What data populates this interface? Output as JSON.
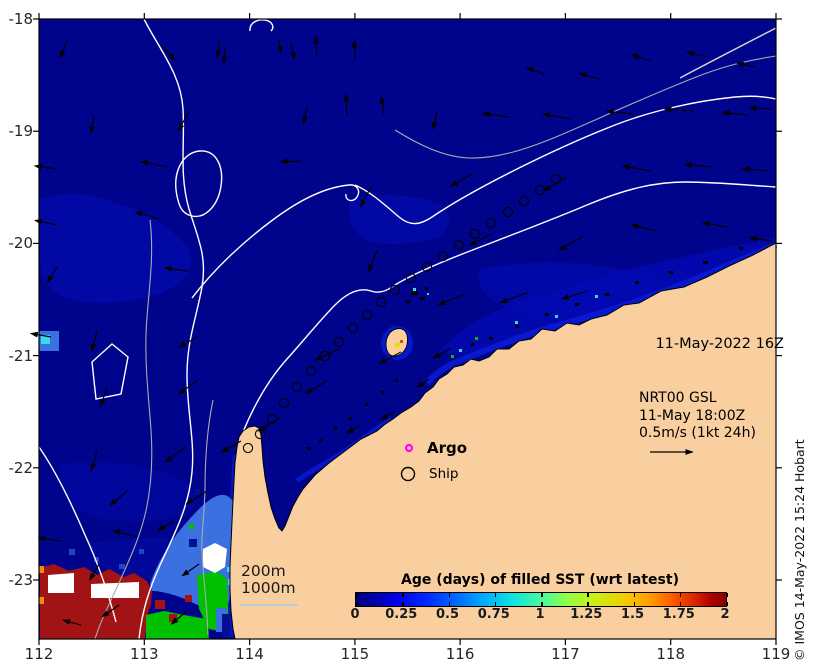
{
  "figure": {
    "date_label": "11-May-2022 16Z",
    "model_label": "NRT00 GSL",
    "model_time_label": "11-May 18:00Z",
    "scale_label": "0.5m/s (1kt 24h)",
    "copyright_label": "© IMOS 14-May-2022 15:24 Hobart"
  },
  "legend": {
    "argo_label": "Argo",
    "ship_label": "Ship"
  },
  "contour_labels": {
    "shallow": "200m",
    "deep": "1000m"
  },
  "colorbar": {
    "title": "Age (days) of filled SST (wrt latest)",
    "tick_labels": [
      "0",
      "0.25",
      "0.5",
      "0.75",
      "1",
      "1.25",
      "1.5",
      "1.75",
      "2"
    ],
    "min": 0,
    "max": 2
  },
  "axes": {
    "x_tick_labels": [
      "112",
      "113",
      "114",
      "115",
      "116",
      "117",
      "118",
      "119"
    ],
    "x_tick_pos": [
      0,
      105.3,
      210.6,
      315.9,
      421.1,
      526.4,
      631.7,
      737
    ],
    "y_tick_labels": [
      "-18",
      "-19",
      "-20",
      "-21",
      "-22",
      "-23"
    ],
    "y_tick_pos": [
      0,
      112.2,
      224.4,
      336.6,
      448.8,
      561
    ]
  },
  "colors": {
    "ocean": "#00038C",
    "land": "#FACFA0",
    "age_old_red": "#A21315",
    "patch_blue": "#3A70E0",
    "patch_green": "#00C000",
    "patch_cyan": "#38D8E8",
    "patch_white": "#FFFFFF",
    "patch_orange": "#F08C10",
    "argo_marker": "#FF00FF",
    "vector_black": "#000000",
    "contour_200m": "#FFFFFF",
    "contour_1000m": "#ABABAB"
  },
  "map": {
    "vectors": [
      [
        28,
        22,
        112,
        18
      ],
      [
        122,
        26,
        48,
        20
      ],
      [
        180,
        22,
        96,
        16
      ],
      [
        252,
        24,
        78,
        16
      ],
      [
        55,
        96,
        100,
        18
      ],
      [
        150,
        92,
        118,
        22
      ],
      [
        268,
        88,
        102,
        16
      ],
      [
        18,
        150,
        188,
        22
      ],
      [
        128,
        148,
        192,
        26
      ],
      [
        262,
        142,
        178,
        20
      ],
      [
        18,
        206,
        192,
        22
      ],
      [
        120,
        200,
        196,
        24
      ],
      [
        148,
        252,
        188,
        22
      ],
      [
        18,
        248,
        122,
        18
      ],
      [
        58,
        312,
        105,
        20
      ],
      [
        158,
        318,
        150,
        20
      ],
      [
        12,
        318,
        190,
        20
      ],
      [
        186,
        28,
        94,
        16
      ],
      [
        240,
        20,
        82,
        14
      ],
      [
        278,
        38,
        266,
        20
      ],
      [
        316,
        42,
        268,
        20
      ],
      [
        345,
        96,
        262,
        18
      ],
      [
        308,
        96,
        267,
        20
      ],
      [
        398,
        92,
        102,
        18
      ],
      [
        470,
        98,
        188,
        26
      ],
      [
        532,
        100,
        190,
        28
      ],
      [
        594,
        95,
        186,
        26
      ],
      [
        654,
        92,
        184,
        28
      ],
      [
        708,
        96,
        186,
        24
      ],
      [
        733,
        90,
        184,
        22
      ],
      [
        612,
        42,
        198,
        20
      ],
      [
        668,
        38,
        194,
        20
      ],
      [
        716,
        48,
        192,
        18
      ],
      [
        560,
        60,
        196,
        20
      ],
      [
        505,
        55,
        200,
        18
      ],
      [
        612,
        152,
        190,
        28
      ],
      [
        672,
        148,
        186,
        26
      ],
      [
        728,
        152,
        186,
        24
      ],
      [
        618,
        212,
        194,
        26
      ],
      [
        688,
        208,
        190,
        24
      ],
      [
        733,
        222,
        188,
        22
      ],
      [
        332,
        168,
        118,
        22
      ],
      [
        338,
        232,
        112,
        22
      ],
      [
        433,
        155,
        150,
        24
      ],
      [
        452,
        215,
        152,
        24
      ],
      [
        527,
        158,
        148,
        26
      ],
      [
        543,
        218,
        150,
        26
      ],
      [
        424,
        276,
        158,
        26
      ],
      [
        488,
        274,
        160,
        28
      ],
      [
        548,
        272,
        162,
        26
      ],
      [
        300,
        330,
        155,
        26
      ],
      [
        362,
        333,
        152,
        24
      ],
      [
        412,
        329,
        150,
        20
      ],
      [
        68,
        368,
        108,
        20
      ],
      [
        158,
        362,
        145,
        22
      ],
      [
        58,
        432,
        106,
        20
      ],
      [
        146,
        428,
        142,
        24
      ],
      [
        202,
        422,
        150,
        22
      ],
      [
        88,
        472,
        140,
        22
      ],
      [
        168,
        472,
        148,
        24
      ],
      [
        242,
        398,
        148,
        26
      ],
      [
        288,
        362,
        150,
        24
      ],
      [
        322,
        406,
        150,
        16
      ],
      [
        356,
        392,
        148,
        16
      ],
      [
        390,
        360,
        145,
        14
      ],
      [
        22,
        522,
        188,
        22
      ],
      [
        98,
        518,
        195,
        24
      ],
      [
        135,
        502,
        150,
        18
      ],
      [
        160,
        545,
        145,
        20
      ],
      [
        60,
        545,
        120,
        18
      ],
      [
        80,
        586,
        145,
        20
      ],
      [
        148,
        592,
        140,
        20
      ],
      [
        42,
        606,
        195,
        18
      ]
    ],
    "track_circles": [
      [
        517,
        160
      ],
      [
        501,
        171
      ],
      [
        485,
        182
      ],
      [
        469,
        193
      ],
      [
        452,
        204
      ],
      [
        436,
        215
      ],
      [
        420,
        226
      ],
      [
        404,
        237
      ],
      [
        388,
        248
      ],
      [
        372,
        259
      ],
      [
        356,
        271
      ],
      [
        342,
        283
      ],
      [
        328,
        296
      ],
      [
        314,
        309
      ],
      [
        300,
        323
      ],
      [
        286,
        337
      ],
      [
        272,
        352
      ],
      [
        258,
        368
      ],
      [
        245,
        384
      ],
      [
        233,
        400
      ],
      [
        221,
        415
      ],
      [
        209,
        429
      ]
    ]
  }
}
